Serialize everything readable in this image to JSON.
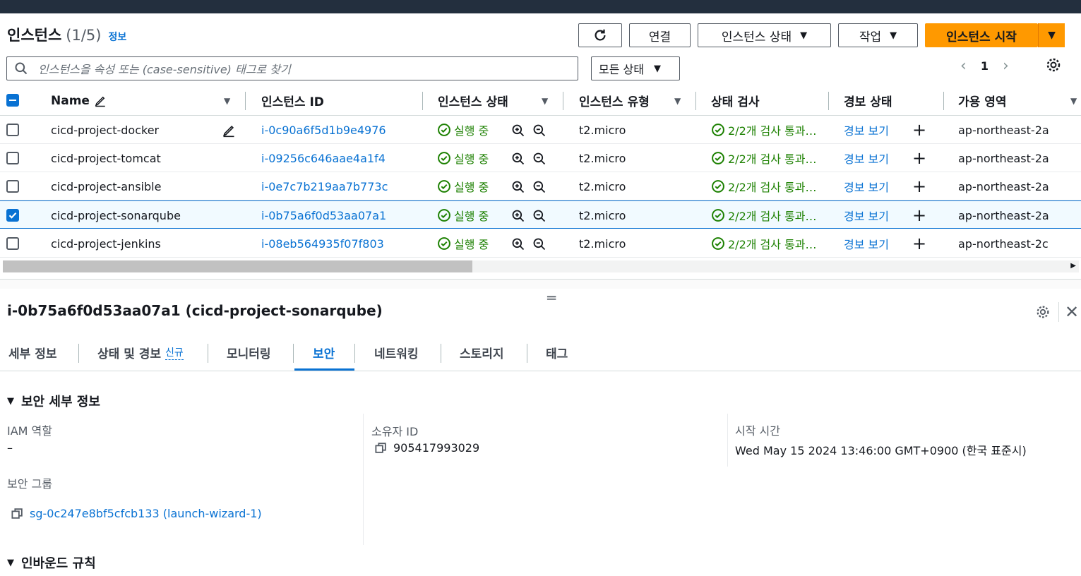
{
  "header": {
    "title": "인스턴스",
    "count": "(1/5)",
    "info_link": "정보"
  },
  "toolbar": {
    "connect_label": "연결",
    "instance_state_label": "인스턴스 상태",
    "actions_label": "작업",
    "launch_label": "인스턴스 시작"
  },
  "search": {
    "placeholder": "인스턴스을 속성 또는 (case-sensitive) 태그로 찾기"
  },
  "filter": {
    "selected": "모든 상태"
  },
  "pagination": {
    "page": "1"
  },
  "table": {
    "columns": {
      "name": "Name",
      "instance_id": "인스턴스 ID",
      "instance_state": "인스턴스 상태",
      "instance_type": "인스턴스 유형",
      "status_check": "상태 검사",
      "alarm_status": "경보 상태",
      "az": "가용 영역"
    },
    "rows": [
      {
        "name": "cicd-project-docker",
        "id": "i-0c90a6f5d1b9e4976",
        "state": "실행 중",
        "type": "t2.micro",
        "check": "2/2개 검사 통과…",
        "alarm": "경보 보기",
        "az": "ap-northeast-2a",
        "selected": false
      },
      {
        "name": "cicd-project-tomcat",
        "id": "i-09256c646aae4a1f4",
        "state": "실행 중",
        "type": "t2.micro",
        "check": "2/2개 검사 통과…",
        "alarm": "경보 보기",
        "az": "ap-northeast-2a",
        "selected": false
      },
      {
        "name": "cicd-project-ansible",
        "id": "i-0e7c7b219aa7b773c",
        "state": "실행 중",
        "type": "t2.micro",
        "check": "2/2개 검사 통과…",
        "alarm": "경보 보기",
        "az": "ap-northeast-2a",
        "selected": false
      },
      {
        "name": "cicd-project-sonarqube",
        "id": "i-0b75a6f0d53aa07a1",
        "state": "실행 중",
        "type": "t2.micro",
        "check": "2/2개 검사 통과…",
        "alarm": "경보 보기",
        "az": "ap-northeast-2a",
        "selected": true
      },
      {
        "name": "cicd-project-jenkins",
        "id": "i-08eb564935f07f803",
        "state": "실행 중",
        "type": "t2.micro",
        "check": "2/2개 검사 통과…",
        "alarm": "경보 보기",
        "az": "ap-northeast-2c",
        "selected": false
      }
    ]
  },
  "detail": {
    "title": "i-0b75a6f0d53aa07a1 (cicd-project-sonarqube)",
    "tabs": [
      "세부 정보",
      "상태 및 경보",
      "모니터링",
      "보안",
      "네트워킹",
      "스토리지",
      "태그"
    ],
    "new_badge": "신규",
    "active_tab": "보안",
    "security_section": "보안 세부 정보",
    "iam_role_label": "IAM 역할",
    "iam_role_value": "–",
    "owner_id_label": "소유자 ID",
    "owner_id_value": "905417993029",
    "launch_time_label": "시작 시간",
    "launch_time_value": "Wed May 15 2024 13:46:00 GMT+0900 (한국 표준시)",
    "security_group_label": "보안 그룹",
    "security_group_value": "sg-0c247e8bf5cfcb133 (launch-wizard-1)",
    "inbound_section": "인바운드 규칙"
  },
  "colors": {
    "brand_orange": "#ff9900",
    "link_blue": "#0972d3",
    "success_green": "#1d8102",
    "topbar": "#232f3e"
  }
}
